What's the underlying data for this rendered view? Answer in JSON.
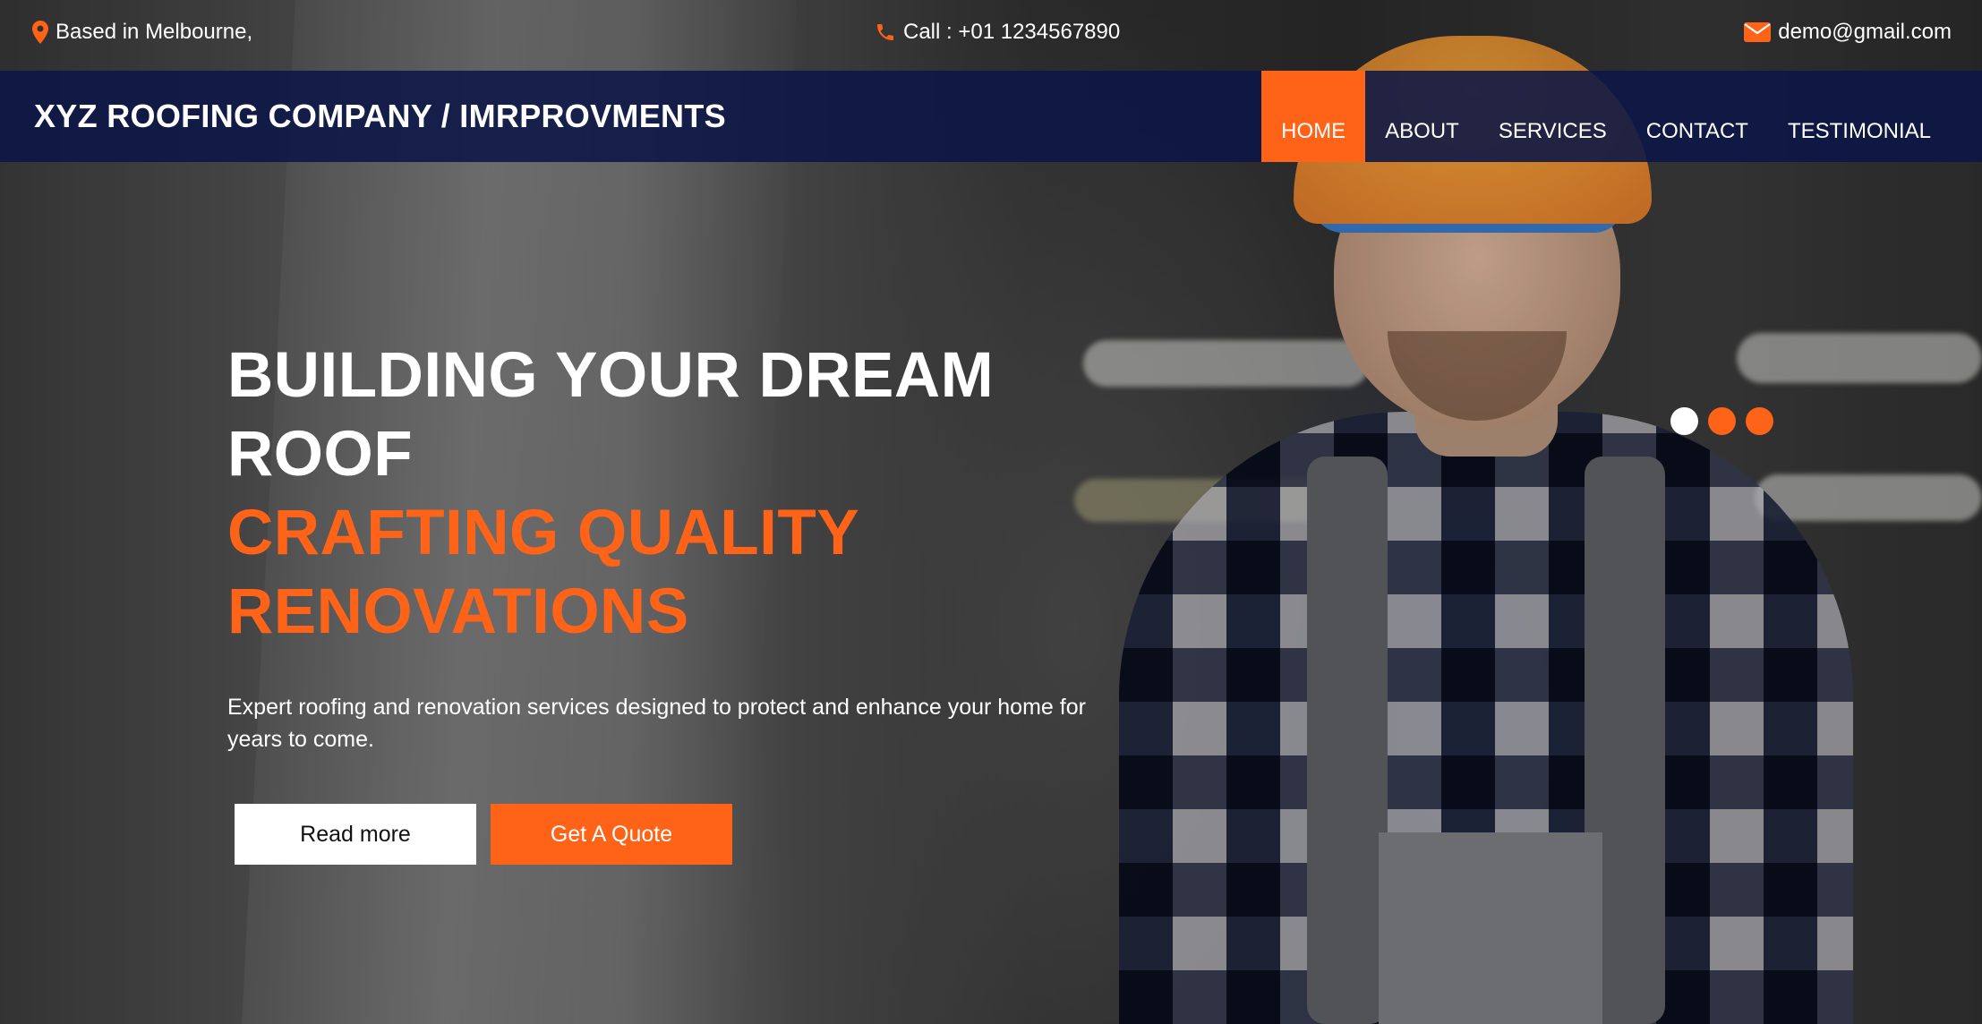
{
  "topbar": {
    "location": {
      "icon": "map-pin-icon",
      "text": "Based in Melbourne,"
    },
    "phone": {
      "icon": "phone-icon",
      "text": "Call : +01 1234567890"
    },
    "email": {
      "icon": "envelope-icon",
      "text": "demo@gmail.com"
    }
  },
  "navbar": {
    "brand": "XYZ ROOFING COMPANY / IMRPROVMENTS",
    "items": [
      {
        "label": "HOME",
        "active": true
      },
      {
        "label": "ABOUT",
        "active": false
      },
      {
        "label": "SERVICES",
        "active": false
      },
      {
        "label": "CONTACT",
        "active": false
      },
      {
        "label": "TESTIMONIAL",
        "active": false
      }
    ]
  },
  "hero": {
    "title_line1": "BUILDING YOUR DREAM",
    "title_line2": "ROOF",
    "subtitle_line1": "CRAFTING QUALITY",
    "subtitle_line2": "RENOVATIONS",
    "description": "Expert roofing and renovation services designed to protect and enhance your home for years to come.",
    "read_more_label": "Read more",
    "quote_label": "Get A Quote"
  },
  "carousel": {
    "slide_count": 3,
    "active_index": 0
  },
  "colors": {
    "accent": "#ff6318",
    "navbar": "#0a1646",
    "text": "#ffffff"
  }
}
